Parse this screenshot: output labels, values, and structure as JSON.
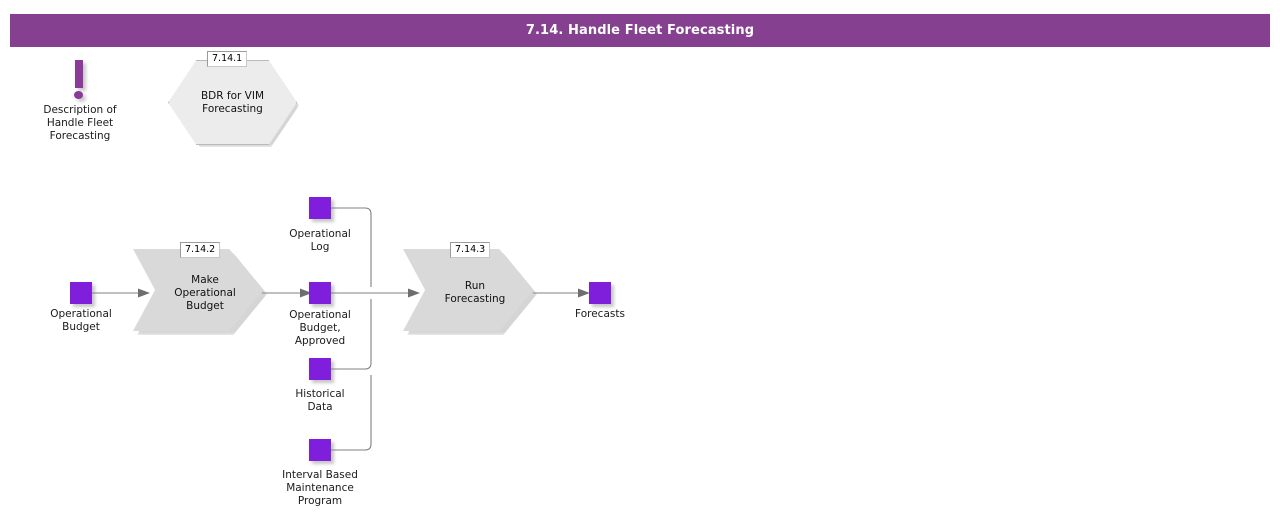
{
  "title_bar": {
    "text": "7.14. Handle Fleet Forecasting",
    "background_color": "#85408F",
    "text_color": "#FFFFFF"
  },
  "palette": {
    "data_object_purple": "#7F1FDC",
    "description_purple": "#8C3A99",
    "process_grey": "#D9D9D9",
    "hexagon_grey": "#ECECEC",
    "connector_grey": "#808080"
  },
  "description": {
    "icon": "exclamation-icon",
    "label": "Description of\nHandle Fleet\nForecasting"
  },
  "shapes": [
    {
      "id": "7.14.1",
      "label": "BDR for VIM\nForecasting",
      "type": "hexagon"
    },
    {
      "id": "7.14.2",
      "label": "Make\nOperational\nBudget",
      "type": "chevron"
    },
    {
      "id": "7.14.3",
      "label": "Run\nForecasting",
      "type": "chevron"
    }
  ],
  "data_objects": [
    {
      "key": "operational_budget",
      "label": "Operational\nBudget"
    },
    {
      "key": "operational_log",
      "label": "Operational\nLog"
    },
    {
      "key": "budget_approved",
      "label": "Operational\nBudget,\nApproved"
    },
    {
      "key": "historical_data",
      "label": "Historical\nData"
    },
    {
      "key": "interval_program",
      "label": "Interval Based\nMaintenance\nProgram"
    },
    {
      "key": "forecasts",
      "label": "Forecasts"
    }
  ]
}
